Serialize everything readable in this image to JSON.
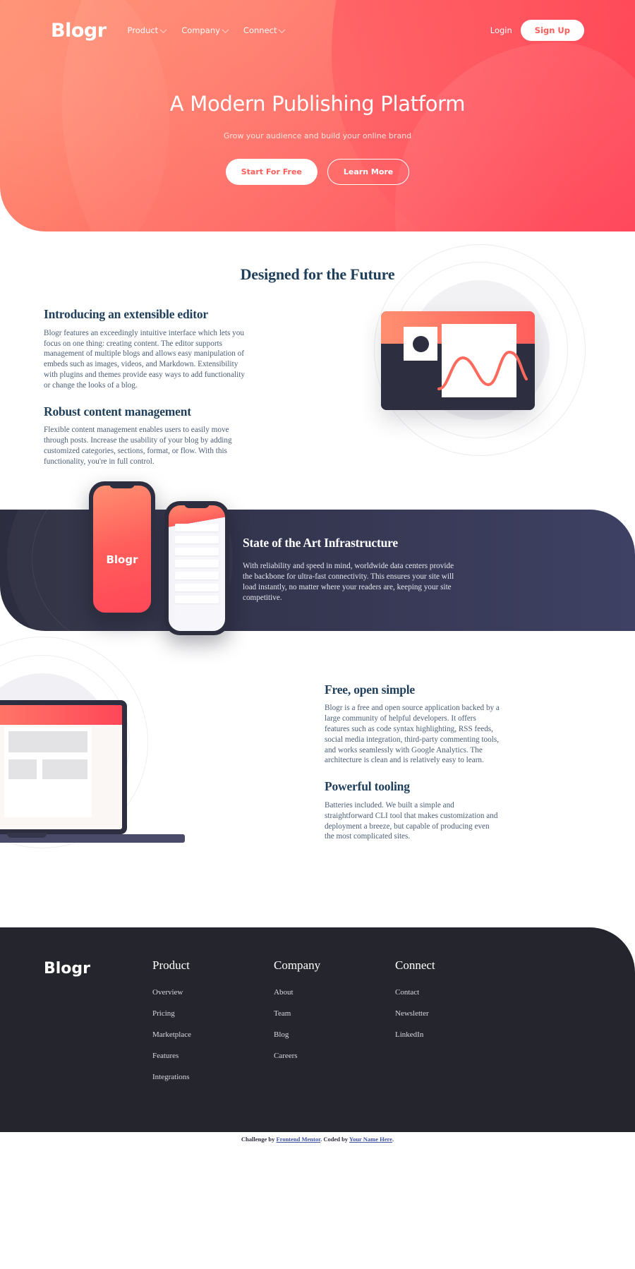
{
  "nav": {
    "brand": "Blogr",
    "links": [
      {
        "label": "Product",
        "icon": "chevron-down-icon"
      },
      {
        "label": "Company",
        "icon": "chevron-down-icon"
      },
      {
        "label": "Connect",
        "icon": "chevron-down-icon"
      }
    ],
    "login_label": "Login",
    "signup_label": "Sign Up"
  },
  "hero": {
    "title": "A Modern Publishing Platform",
    "subtitle": "Grow your audience and build your online brand",
    "primary_cta": "Start For Free",
    "secondary_cta": "Learn More"
  },
  "future": {
    "section_title": "Designed for the Future",
    "blocks": [
      {
        "heading": "Introducing an extensible editor",
        "body": "Blogr features an exceedingly intuitive interface which lets you focus on one thing: creating content. The editor supports management of multiple blogs and allows easy manipulation of embeds such as images, videos, and Markdown. Extensibility with plugins and themes provide easy ways to add functionality or change the looks of a blog."
      },
      {
        "heading": "Robust content management",
        "body": "Flexible content management enables users to easily move through posts. Increase the usability of your blog by adding customized categories, sections, format, or flow. With this functionality, you're in full control."
      }
    ]
  },
  "infrastructure": {
    "heading": "State of the Art Infrastructure",
    "body": "With reliability and speed in mind, worldwide data centers provide the backbone for ultra-fast connectivity. This ensures your site will load instantly, no matter where your readers are, keeping your site competitive.",
    "phone_logo": "Blogr"
  },
  "free": {
    "blocks": [
      {
        "heading": "Free, open simple",
        "body": "Blogr is a free and open source application backed by a large community of helpful developers. It offers features such as code syntax highlighting, RSS feeds, social media integration, third-party commenting tools, and works seamlessly with Google Analytics. The architecture is clean and is relatively easy to learn."
      },
      {
        "heading": "Powerful tooling",
        "body": "Batteries included. We built a simple and straightforward CLI tool that makes customization and deployment a breeze, but capable of producing even the most complicated sites."
      }
    ]
  },
  "footer": {
    "brand": "Blogr",
    "columns": [
      {
        "heading": "Product",
        "links": [
          "Overview",
          "Pricing",
          "Marketplace",
          "Features",
          "Integrations"
        ]
      },
      {
        "heading": "Company",
        "links": [
          "About",
          "Team",
          "Blog",
          "Careers"
        ]
      },
      {
        "heading": "Connect",
        "links": [
          "Contact",
          "Newsletter",
          "LinkedIn"
        ]
      }
    ]
  },
  "attribution": {
    "prefix": "Challenge by ",
    "link1": "Frontend Mentor",
    "middle": ". Coded by ",
    "link2": "Your Name Here",
    "suffix": "."
  },
  "colors": {
    "accent_light": "#ff8f70",
    "accent": "#ff5e5b",
    "accent_deep": "#ff3d54",
    "dark_navy": "#2d2e3f",
    "footer_bg": "#25252d",
    "heading": "#1f3f5b"
  }
}
